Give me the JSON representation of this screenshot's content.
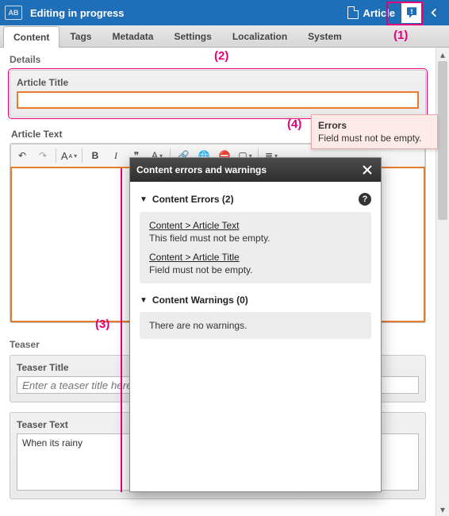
{
  "topbar": {
    "title": "Editing in progress",
    "article_label": "Article",
    "logo": "AB"
  },
  "tabs": [
    "Content",
    "Tags",
    "Metadata",
    "Settings",
    "Localization",
    "System"
  ],
  "details": {
    "header": "Details",
    "article_title_label": "Article Title",
    "article_title_value": "",
    "article_text_label": "Article Text"
  },
  "toolbar": {
    "undo": "↶",
    "redo": "↷",
    "font_plus": "A",
    "font_minus": "ᴀ",
    "bold": "B",
    "italic": "I",
    "quote": "❞",
    "font": "A",
    "link": "🔗",
    "world": "🌐",
    "unlink": "⛔",
    "img": "▢",
    "align": "≣"
  },
  "teaser": {
    "header": "Teaser",
    "title_label": "Teaser Title",
    "title_placeholder": "Enter a teaser title here.",
    "text_label": "Teaser Text",
    "text_value": "When its rainy"
  },
  "tooltip": {
    "title": "Errors",
    "body": "Field must not be empty."
  },
  "panel": {
    "title": "Content errors and warnings",
    "errors_header": "Content Errors (2)",
    "warnings_header": "Content Warnings (0)",
    "errors": [
      {
        "path": "Content > Article Text",
        "msg": "This field must not be empty."
      },
      {
        "path": "Content > Article Title",
        "msg": "Field must not be empty."
      }
    ],
    "no_warnings": "There are no warnings."
  },
  "callouts": {
    "c1": "(1)",
    "c2": "(2)",
    "c3": "(3)",
    "c4": "(4)"
  }
}
